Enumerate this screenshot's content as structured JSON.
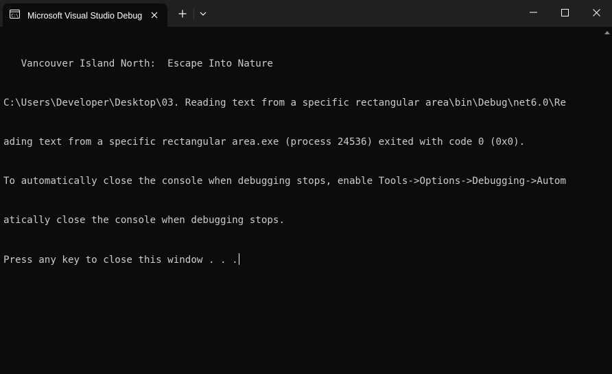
{
  "tab": {
    "title": "Microsoft Visual Studio Debug Console",
    "icon": "console-icon"
  },
  "titlebar": {
    "new_tab_icon": "plus-icon",
    "dropdown_icon": "chevron-down-icon",
    "minimize_icon": "minimize-icon",
    "maximize_icon": "maximize-icon",
    "close_icon": "close-icon"
  },
  "console": {
    "lines": [
      "   Vancouver Island North:  Escape Into Nature",
      "C:\\Users\\Developer\\Desktop\\03. Reading text from a specific rectangular area\\bin\\Debug\\net6.0\\Re",
      "ading text from a specific rectangular area.exe (process 24536) exited with code 0 (0x0).",
      "To automatically close the console when debugging stops, enable Tools->Options->Debugging->Autom",
      "atically close the console when debugging stops.",
      "Press any key to close this window . . ."
    ]
  },
  "colors": {
    "background": "#0c0c0c",
    "titlebar": "#202020",
    "text": "#cccccc"
  }
}
